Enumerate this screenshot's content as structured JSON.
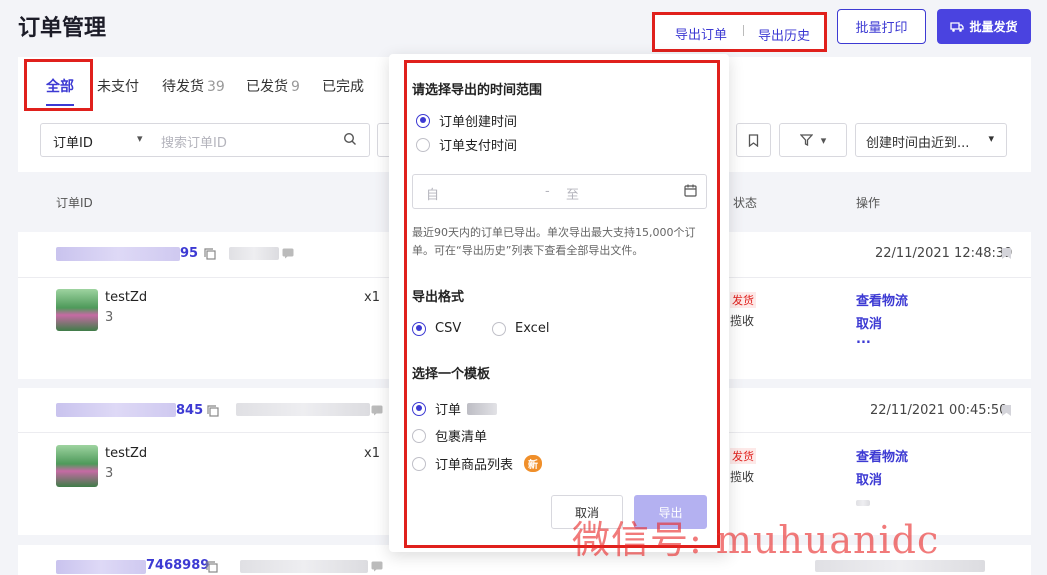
{
  "header": {
    "title": "订单管理",
    "export_order": "导出订单",
    "export_history": "导出历史",
    "batch_print": "批量打印",
    "batch_ship": "批量发货"
  },
  "tabs": [
    {
      "label": "全部",
      "count": ""
    },
    {
      "label": "未支付",
      "count": ""
    },
    {
      "label": "待发货",
      "count": "39"
    },
    {
      "label": "已发货",
      "count": "9"
    },
    {
      "label": "已完成",
      "count": ""
    }
  ],
  "filters": {
    "search_field": "订单ID",
    "search_placeholder": "搜索订单ID",
    "sort": "创建时间由近到..."
  },
  "table": {
    "col_order_id": "订单ID",
    "col_status": "状态",
    "col_actions": "操作"
  },
  "orders": [
    {
      "id_tail": "95",
      "time": "22/11/2021 12:48:39",
      "product": "testZd",
      "sku": "3",
      "qty": "x1",
      "status": "发货",
      "status_sub": "揽收",
      "actions": [
        "查看物流",
        "取消",
        "..."
      ]
    },
    {
      "id_tail": "845",
      "time": "22/11/2021 00:45:50",
      "product": "testZd",
      "sku": "3",
      "qty": "x1",
      "status": "发货",
      "status_sub": "揽收",
      "actions": [
        "查看物流",
        "取消"
      ]
    },
    {
      "id_tail": "7468989"
    }
  ],
  "export_popover": {
    "time_range_title": "请选择导出的时间范围",
    "time_options": [
      "订单创建时间",
      "订单支付时间"
    ],
    "selected_time": "订单创建时间",
    "date_from_placeholder": "自",
    "date_sep": "-",
    "date_to_placeholder": "至",
    "note": "最近90天内的订单已导出。单次导出最大支持15,000个订单。可在“导出历史”列表下查看全部导出文件。",
    "format_title": "导出格式",
    "formats": [
      "CSV",
      "Excel"
    ],
    "selected_format": "CSV",
    "template_title": "选择一个模板",
    "templates": [
      "订单",
      "包裹清单",
      "订单商品列表"
    ],
    "selected_template": "订单",
    "new_badge": "新",
    "cancel": "取消",
    "export": "导出"
  },
  "watermark": "微信号: muhuanidc",
  "colors": {
    "accent": "#3d3ad3",
    "highlight_frame": "#e0201c",
    "status_red": "#e0201c",
    "badge_new": "#f08f2a"
  }
}
